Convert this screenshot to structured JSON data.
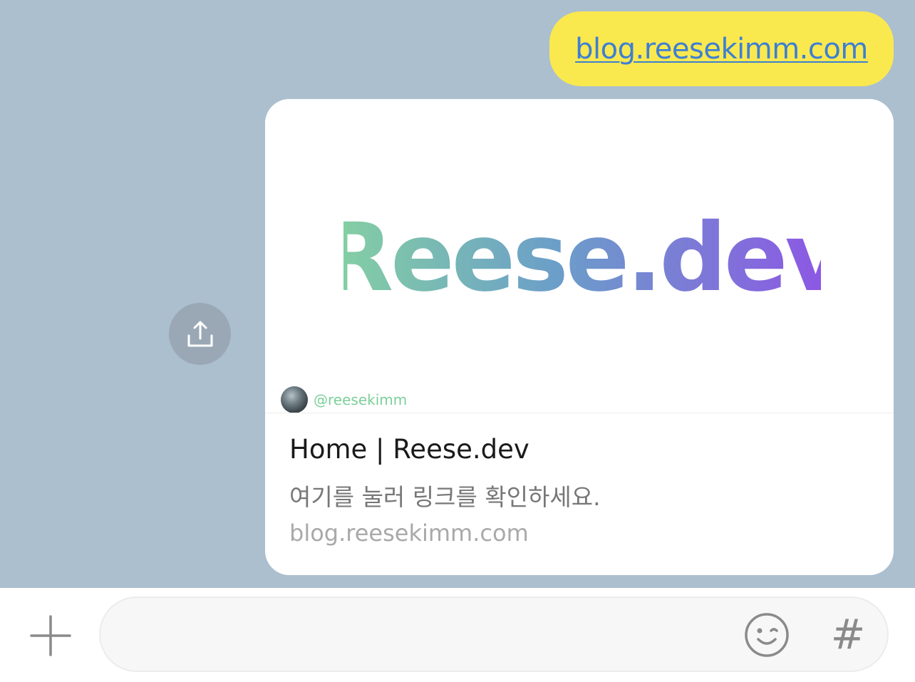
{
  "chat": {
    "sent_message": {
      "text": "blog.reesekimm.com"
    },
    "share_icon": "share-icon",
    "link_preview": {
      "logo_text": "Reese.dev",
      "logo_gradient": [
        "#86d3a0",
        "#6b9ec9",
        "#8f52e6"
      ],
      "author_handle": "@reesekimm",
      "title": "Home | Reese.dev",
      "description": "여기를 눌러 링크를 확인하세요.",
      "domain": "blog.reesekimm.com"
    }
  },
  "input_bar": {
    "add_icon": "plus-icon",
    "message_value": "",
    "emoji_icon": "emoji-icon",
    "hashtag_label": "#"
  },
  "colors": {
    "chat_background": "#abbfcf",
    "sent_bubble": "#fae84f",
    "link_color": "#3d7fd3",
    "handle_color": "#7ccf9a"
  }
}
